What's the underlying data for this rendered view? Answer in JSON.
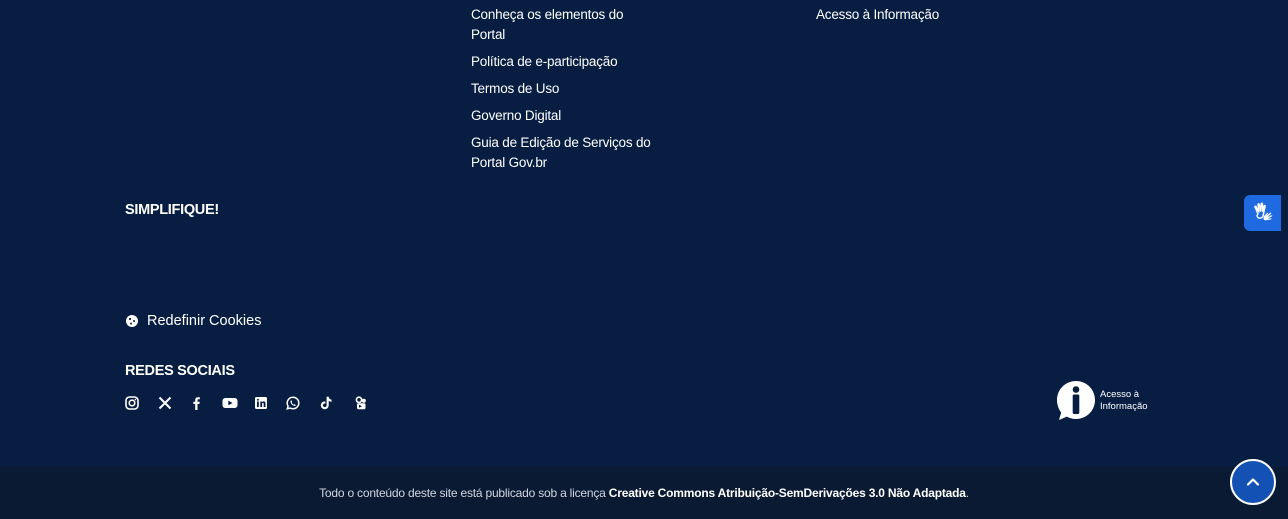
{
  "footer": {
    "col1_links": [
      {
        "label": "Conheça os elementos do Portal"
      },
      {
        "label": "Política de e-participação"
      },
      {
        "label": "Termos de Uso"
      },
      {
        "label": "Governo Digital"
      },
      {
        "label": "Guia de Edição de Serviços do Portal Gov.br"
      }
    ],
    "col2_links": [
      {
        "label": "Acesso à Informação"
      }
    ],
    "simplifique_heading": "SIMPLIFIQUE!",
    "cookies_label": "Redefinir Cookies",
    "social_heading": "REDES SOCIAIS",
    "social_icons": [
      "instagram-icon",
      "x-icon",
      "facebook-icon",
      "youtube-icon",
      "linkedin-icon",
      "whatsapp-icon",
      "tiktok-icon",
      "flickr-icon"
    ],
    "lai_label_line1": "Acesso à",
    "lai_label_line2": "Informação"
  },
  "license": {
    "prefix": "Todo o conteúdo deste site está publicado sob a licença ",
    "license_name": "Creative Commons Atribuição-SemDerivações 3.0 Não Adaptada",
    "suffix": "."
  },
  "colors": {
    "background": "#071d41",
    "bottom_bar": "#0b1a33",
    "accent": "#1351b4",
    "vlibras": "#1f6ae0"
  }
}
